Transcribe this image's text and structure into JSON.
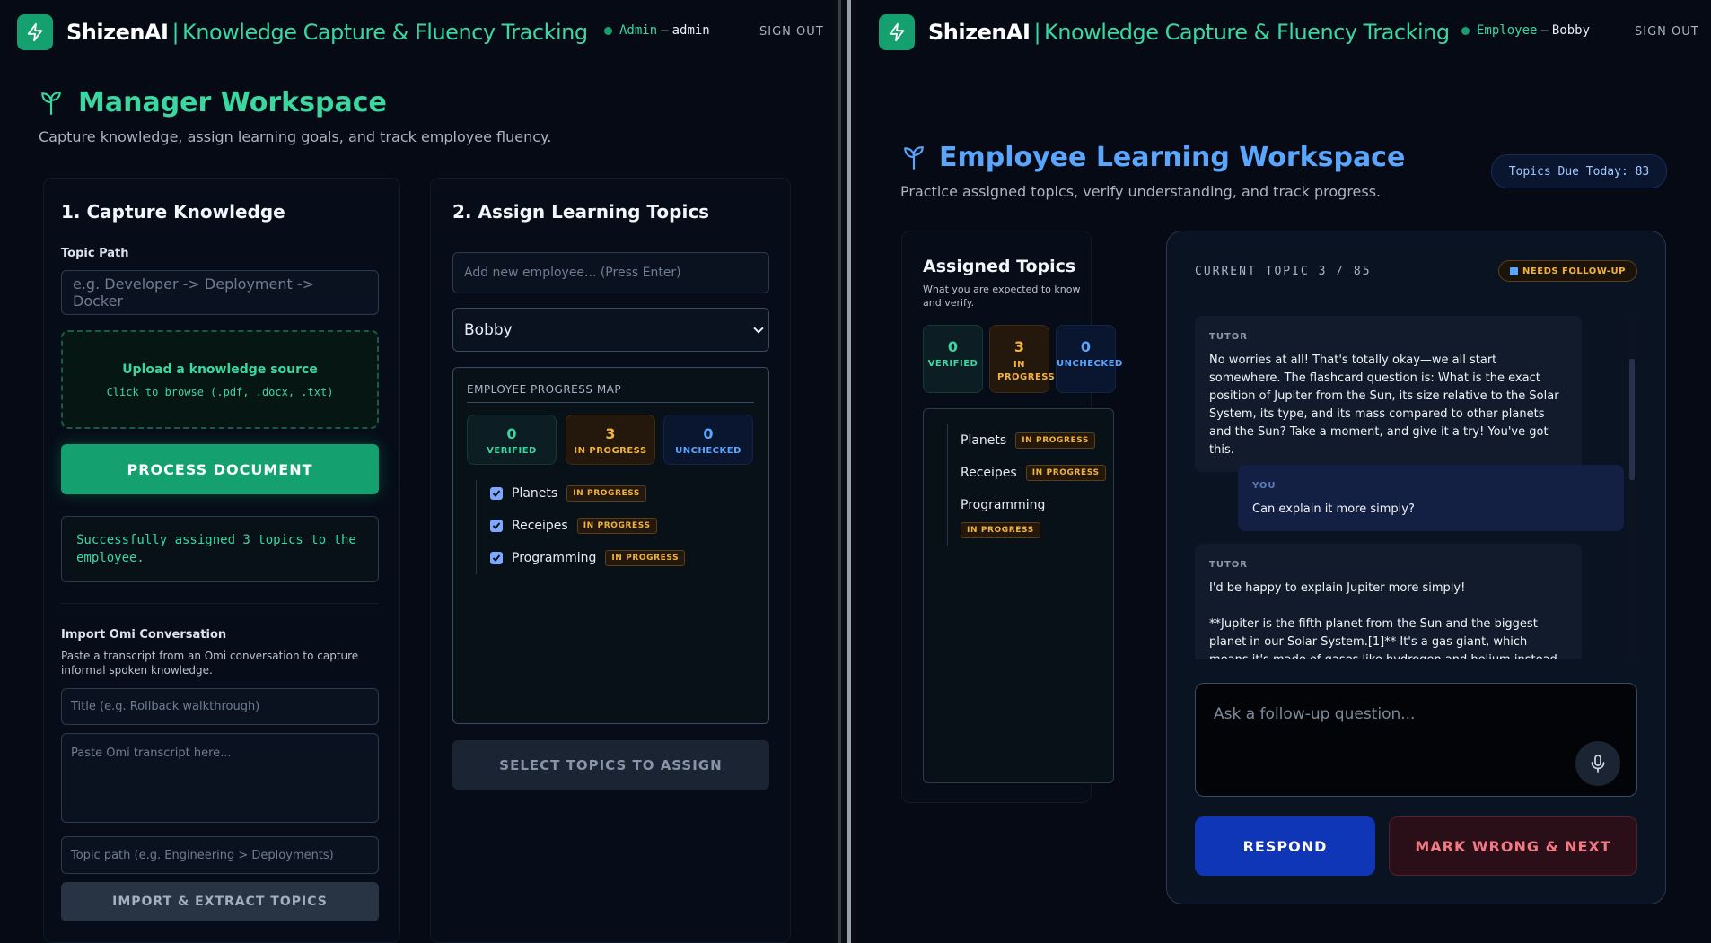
{
  "brand": {
    "name": "ShizenAI",
    "separator": "|",
    "tagline": "Knowledge Capture & Fluency Tracking"
  },
  "colors": {
    "accent_green": "#14a06f",
    "accent_teal": "#3ad7a0",
    "accent_blue": "#5aa6ff",
    "amber": "#f2b33c",
    "background": "#050a14"
  },
  "manager": {
    "user": {
      "role": "Admin",
      "separator": "—",
      "name": "admin"
    },
    "signout_label": "SIGN OUT",
    "workspace_title": "Manager Workspace",
    "workspace_subtitle": "Capture knowledge, assign learning goals, and track employee fluency.",
    "capture": {
      "heading": "1. Capture Knowledge",
      "topic_path_label": "Topic Path",
      "topic_path_placeholder": "e.g. Developer -> Deployment -> Docker",
      "upload_title": "Upload a knowledge source",
      "upload_hint": "Click to browse (.pdf, .docx, .txt)",
      "process_button": "PROCESS DOCUMENT",
      "status_message": "Successfully assigned 3 topics to the employee.",
      "omi_heading": "Import Omi Conversation",
      "omi_hint": "Paste a transcript from an Omi conversation to capture informal spoken knowledge.",
      "omi_title_placeholder": "Title (e.g. Rollback walkthrough)",
      "omi_transcript_placeholder": "Paste Omi transcript here...",
      "omi_topic_placeholder": "Topic path (e.g. Engineering > Deployments)",
      "import_button": "IMPORT & EXTRACT TOPICS"
    },
    "assign": {
      "heading": "2. Assign Learning Topics",
      "add_employee_placeholder": "Add new employee... (Press Enter)",
      "selected_employee": "Bobby",
      "map_title": "EMPLOYEE PROGRESS MAP",
      "stats": {
        "verified": "0",
        "verified_label": "VERIFIED",
        "in_progress": "3",
        "in_progress_label": "IN PROGRESS",
        "unchecked": "0",
        "unchecked_label": "UNCHECKED"
      },
      "topics": [
        {
          "name": "Planets",
          "status": "IN PROGRESS",
          "checked": true
        },
        {
          "name": "Receipes",
          "status": "IN PROGRESS",
          "checked": true
        },
        {
          "name": "Programming",
          "status": "IN PROGRESS",
          "checked": true
        }
      ],
      "assign_button": "SELECT TOPICS TO ASSIGN"
    }
  },
  "employee": {
    "user": {
      "role": "Employee",
      "separator": "—",
      "name": "Bobby"
    },
    "signout_label": "SIGN OUT",
    "workspace_title": "Employee Learning Workspace",
    "workspace_subtitle": "Practice assigned topics, verify understanding, and track progress.",
    "due_today": "Topics Due Today: 83",
    "assigned": {
      "heading": "Assigned Topics",
      "hint": "What you are expected to know and verify.",
      "stats": {
        "verified": "0",
        "verified_label": "VERIFIED",
        "in_progress": "3",
        "in_progress_label": "IN PROGRESS",
        "unchecked": "0",
        "unchecked_label": "UNCHECKED"
      },
      "topics": [
        {
          "name": "Planets",
          "status": "IN PROGRESS"
        },
        {
          "name": "Receipes",
          "status": "IN PROGRESS"
        },
        {
          "name": "Programming",
          "status": "IN PROGRESS"
        }
      ]
    },
    "chat": {
      "current_topic": "CURRENT TOPIC 3 / 85",
      "follow_badge": "NEEDS FOLLOW-UP",
      "messages": [
        {
          "who": "TUTOR",
          "text": "No worries at all! That's totally okay—we all start somewhere. The flashcard question is: What is the exact position of Jupiter from the Sun, its size relative to the Solar System, its type, and its mass compared to other planets and the Sun? Take a moment, and give it a try! You've got this."
        },
        {
          "who": "YOU",
          "text": "Can explain  it  more simply?"
        },
        {
          "who": "TUTOR",
          "text": "I'd be happy to explain Jupiter more simply!",
          "text2": "**Jupiter is the fifth planet from the Sun and the biggest planet in our Solar System.[1]** It's a gas giant, which means it's made of gases like hydrogen and helium instead of solid rock like"
        }
      ],
      "input_placeholder": "Ask a follow-up question...",
      "respond_button": "RESPOND",
      "wrong_button": "MARK WRONG & NEXT"
    }
  },
  "icons": {
    "logo": "bolt-icon",
    "workspace": "sprout-icon",
    "mic": "mic-icon",
    "check": "check-icon",
    "chevron": "chevron-down-icon"
  }
}
